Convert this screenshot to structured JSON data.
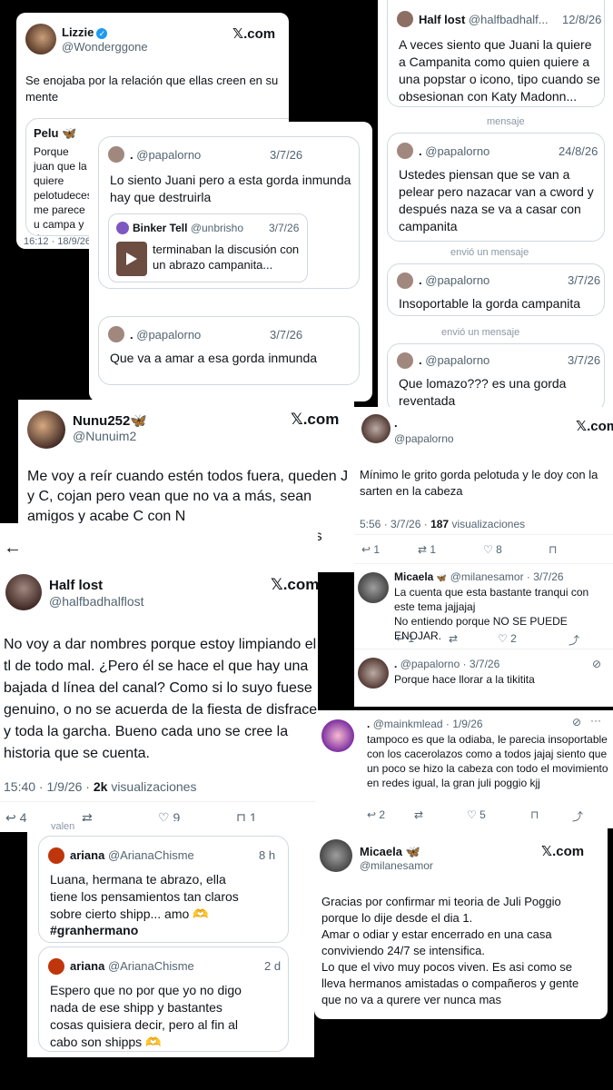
{
  "xlogo": "𝕏.com",
  "c1": {
    "name": "Lizzie",
    "handle": "@Wonderggone",
    "text": "Se enojaba por la relación que ellas creen en su mente",
    "q_name": "Pelu",
    "q_text": "Porque juan que la quiere pelotudeces me parece u campa y de",
    "time": "16:12 · 18/9/26"
  },
  "c2": {
    "q1": {
      "name": ".",
      "handle": "@papalorno",
      "date": "3/7/26",
      "text": "Lo siento Juani pero a esta gorda inmunda hay que destruirla"
    },
    "nested": {
      "name": "Binker Tell",
      "handle": "@unbrisho",
      "date": "3/7/26",
      "text": "terminaban la discusión con un abrazo campanita..."
    },
    "q2": {
      "name": ".",
      "handle": "@papalorno",
      "date": "3/7/26",
      "text": "Que va a amar a esa gorda inmunda"
    }
  },
  "c3": {
    "m1": {
      "name": "Half lost",
      "handle": "@halfbadhalf...",
      "date": "12/8/26",
      "text": "A veces siento que Juani la quiere a Campanita como quien quiere a una popstar o icono, tipo cuando se obsesionan con Katy Madonn..."
    },
    "sys1": "mensaje",
    "m2": {
      "name": ".",
      "handle": "@papalorno",
      "date": "24/8/26",
      "text": "Ustedes piensan que se van a pelear pero nazacar van a cword y después naza se va a casar con campanita"
    },
    "sys2": "envió un mensaje",
    "m3": {
      "name": ".",
      "handle": "@papalorno",
      "date": "3/7/26",
      "text": "Insoportable la gorda campanita"
    },
    "sys3": "envió un mensaje",
    "m4": {
      "name": ".",
      "handle": "@papalorno",
      "date": "3/7/26",
      "text": "Que lomazo??? es una gorda reventada"
    }
  },
  "c4": {
    "name": "Nunu252",
    "handle": "@Nunuim2",
    "text": "Me voy a reír cuando estén todos fuera, queden J y C, cojan pero vean que no va a más, sean amigos y acabe C con N\nAhí quiero ver comunicados llorones de todos"
  },
  "c5": {
    "name": ".",
    "handle": "@papalorno",
    "text": "Mínimo le grito gorda pelotuda y le doy con la sarten en la cabeza",
    "time": "5:56 · 3/7/26 ·",
    "views": "187",
    "views_label": "visualizaciones",
    "replies": "1",
    "reposts": "1",
    "likes": "8",
    "r1": {
      "name": "Micaela",
      "handle": "@milanesamor · 3/7/26",
      "text": "La cuenta que esta bastante tranqui con este tema jajjajaj\nNo entiendo porque NO SE PUEDE ENOJAR.",
      "replies": "1",
      "likes": "2"
    },
    "r2": {
      "name": ".",
      "handle": "@papalorno · 3/7/26",
      "text": "Porque hace llorar a la tikitita"
    }
  },
  "c6": {
    "name": "Half lost",
    "handle": "@halfbadhalflost",
    "text": "No voy a dar nombres porque estoy limpiando el tl de todo mal. ¿Pero él se hace el que hay una bajada d línea del canal? Como si lo suyo fuese genuino, o no se acuerda de la fiesta de disfraces y toda la garcha. Bueno cada uno se cree la historia que se cuenta.",
    "time": "15:40 · 1/9/26 ·",
    "views": "2k",
    "views_label": "visualizaciones",
    "replies": "4",
    "likes": "9",
    "bookmarks": "1"
  },
  "c7": {
    "name": ".",
    "handle": "@mainkmlead · 1/9/26",
    "text": "tampoco es que la odiaba, le parecia insoportable con los cacerolazos como a todos jajaj siento que un poco se hizo la cabeza con todo el movimiento en redes igual, la gran juli poggio kjj",
    "replies": "2",
    "likes": "5"
  },
  "c8": {
    "sys": "valen",
    "m1": {
      "name": "ariana",
      "handle": "@ArianaChisme",
      "date": "8 h",
      "text": "Luana, hermana te abrazo, ella tiene los pensamientos tan claros sobre cierto shipp... amo 🫶",
      "tag": "#granhermano"
    },
    "m2": {
      "name": "ariana",
      "handle": "@ArianaChisme",
      "date": "2 d",
      "text": "Espero que no por que yo no digo nada de ese shipp y bastantes cosas quisiera decir, pero al fin al cabo son shipps 🫶"
    }
  },
  "c9": {
    "name": "Micaela",
    "handle": "@milanesamor",
    "text": "Gracias por confirmar mi teoria de Juli Poggio porque lo dije desde el dia 1.\nAmar o odiar y estar encerrado en una casa conviviendo 24/7 se intensifica.\nLo que el vivo muy pocos viven. Es asi como se lleva hermanos amistadas o compañeros y gente que no va a qurere ver nunca mas"
  },
  "colors": {
    "accent": "#1d9bf0",
    "text": "#0f1419",
    "muted": "#536471"
  }
}
